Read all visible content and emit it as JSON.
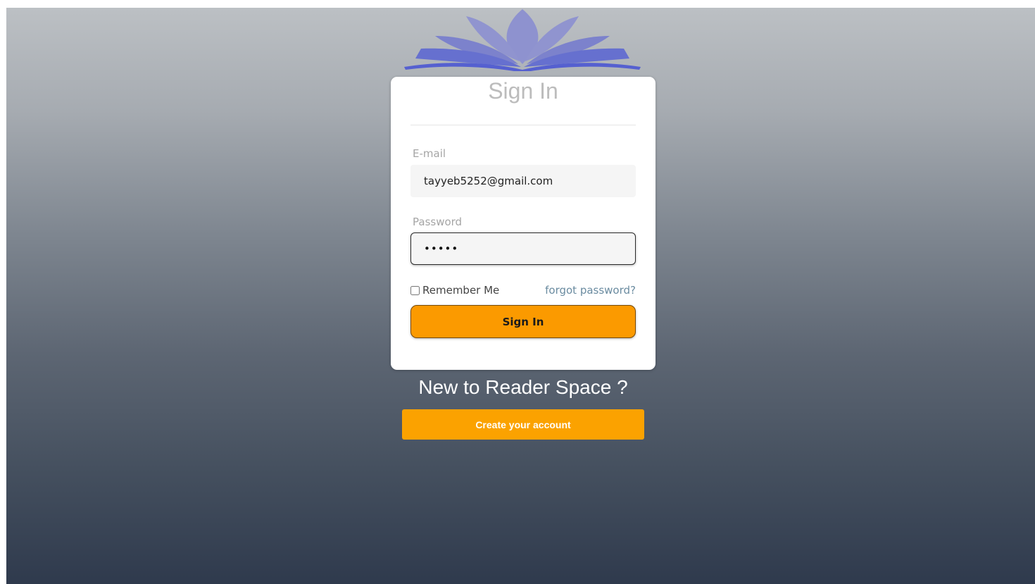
{
  "brand": {
    "logo_icon": "open-book-lotus-icon",
    "logo_color": "#8c90d0",
    "logo_base_color": "#5b6ad4"
  },
  "signin_card": {
    "title": "Sign In",
    "email": {
      "label": "E-mail",
      "value": "tayyeb5252@gmail.com"
    },
    "password": {
      "label": "Password",
      "masked_value": "•••••"
    },
    "remember_me_label": "Remember Me",
    "remember_me_checked": false,
    "forgot_password_label": "forgot password?",
    "submit_label": "Sign In"
  },
  "signup": {
    "prompt": "New to Reader Space ?",
    "button_label": "Create your account"
  },
  "colors": {
    "accent_orange": "#fb9a00",
    "create_button_orange": "#fba200",
    "link_color": "#6a8ba0"
  }
}
